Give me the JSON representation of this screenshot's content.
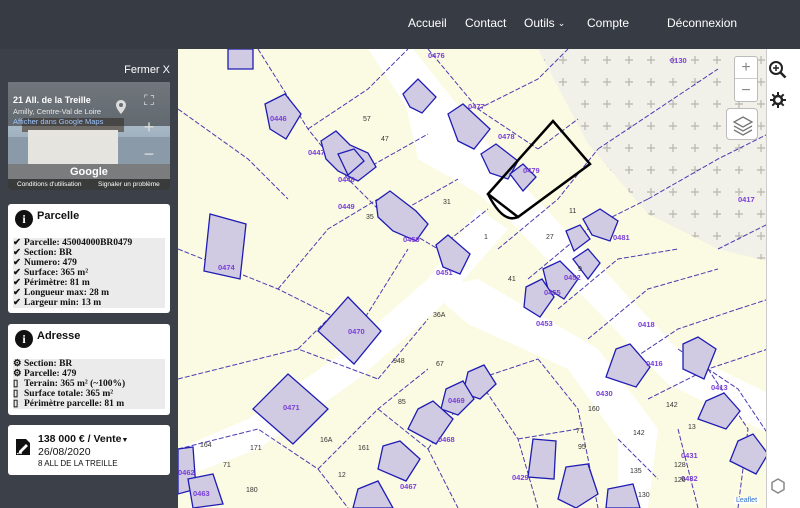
{
  "nav": {
    "home": "Accueil",
    "contact": "Contact",
    "tools": "Outils",
    "account": "Compte",
    "logout": "Déconnexion"
  },
  "sidebar": {
    "close": "Fermer X",
    "streetview": {
      "address": "21 All. de la Treille",
      "city": "Amilly, Centre-Val de Loire",
      "maps_link": "Afficher dans Google Maps",
      "brand": "Google",
      "terms": "Conditions d'utilisation",
      "report": "Signaler un problème"
    },
    "parcelle": {
      "title": "Parcelle",
      "rows": [
        "Parcelle: 45004000BR0479",
        "Section: BR",
        "Numero: 479",
        "Surface: 365 m²",
        "Périmètre: 81 m",
        "Longueur max: 28 m",
        "Largeur min: 13 m"
      ]
    },
    "adresse": {
      "title": "Adresse",
      "rows": [
        "Section: BR",
        "Parcelle: 479",
        "Terrain: 365 m² (~100%)",
        "Surface totale: 365 m²",
        "Périmètre parcelle: 81 m"
      ]
    },
    "sale": {
      "title": "138 000 € / Vente",
      "date": "26/08/2020",
      "address": "8 ALL DE LA TREILLE"
    }
  },
  "map": {
    "parcel_labels": [
      "0476",
      "0130",
      "0446",
      "0477",
      "0478",
      "0479",
      "0447",
      "0448",
      "0449",
      "0450",
      "0451",
      "0474",
      "0417",
      "0481",
      "0452",
      "0453",
      "0418",
      "0470",
      "0455",
      "0416",
      "0413",
      "0430",
      "0469",
      "0471",
      "0468",
      "0429",
      "0462",
      "0463",
      "0467",
      "0431",
      "0432"
    ],
    "street_numbers": [
      "57",
      "47",
      "31",
      "35",
      "1",
      "11",
      "27",
      "41",
      "9",
      "36A",
      "948",
      "67",
      "85",
      "164",
      "171",
      "12",
      "16A",
      "161",
      "180",
      "142",
      "160",
      "128",
      "126",
      "135",
      "130",
      "13",
      "77",
      "95",
      "71",
      "142"
    ],
    "attribution": "Leaflet",
    "zoom_in": "+",
    "zoom_out": "−"
  }
}
